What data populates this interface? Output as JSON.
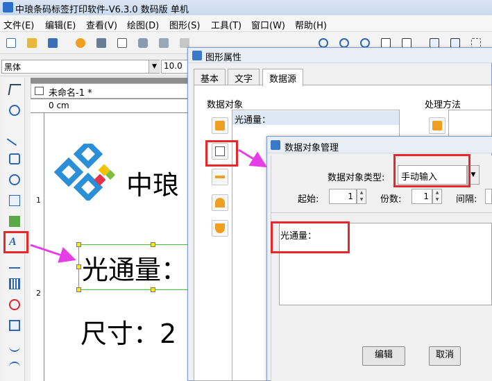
{
  "app": {
    "title": "中琅条码标签打印软件-V6.3.0 数码版 单机"
  },
  "menu": [
    "文件(E)",
    "编辑(E)",
    "查看(V)",
    "绘图(D)",
    "图形(S)",
    "工具(T)",
    "窗口(W)",
    "帮助(H)"
  ],
  "font_row": {
    "font": "黑体",
    "size": "10.0"
  },
  "document": {
    "tab": "未命名-1 *",
    "ruler_h": "0 cm",
    "ruler_v_1": "1",
    "ruler_v_2": "2",
    "company": "中琅",
    "label_optical": "光通量：",
    "label_size": "尺寸：2"
  },
  "dialog_props": {
    "title": "图形属性",
    "tabs": [
      "基本",
      "文字",
      "数据源"
    ],
    "group_data_object": "数据对象",
    "group_process": "处理方法",
    "list_item": "光通量："
  },
  "dialog_data": {
    "title": "数据对象管理",
    "type_label": "数据对象类型:",
    "type_value": "手动输入",
    "start_label": "起始:",
    "start_value": "1",
    "copies_label": "份数:",
    "copies_value": "1",
    "interval_label": "间隔:",
    "content": "光通量：",
    "edit_button": "编辑",
    "cancel_button": "取消"
  },
  "colors": {
    "highlight": "#e8272a",
    "arrow": "#e63ee6",
    "selection": "#39c63b"
  }
}
